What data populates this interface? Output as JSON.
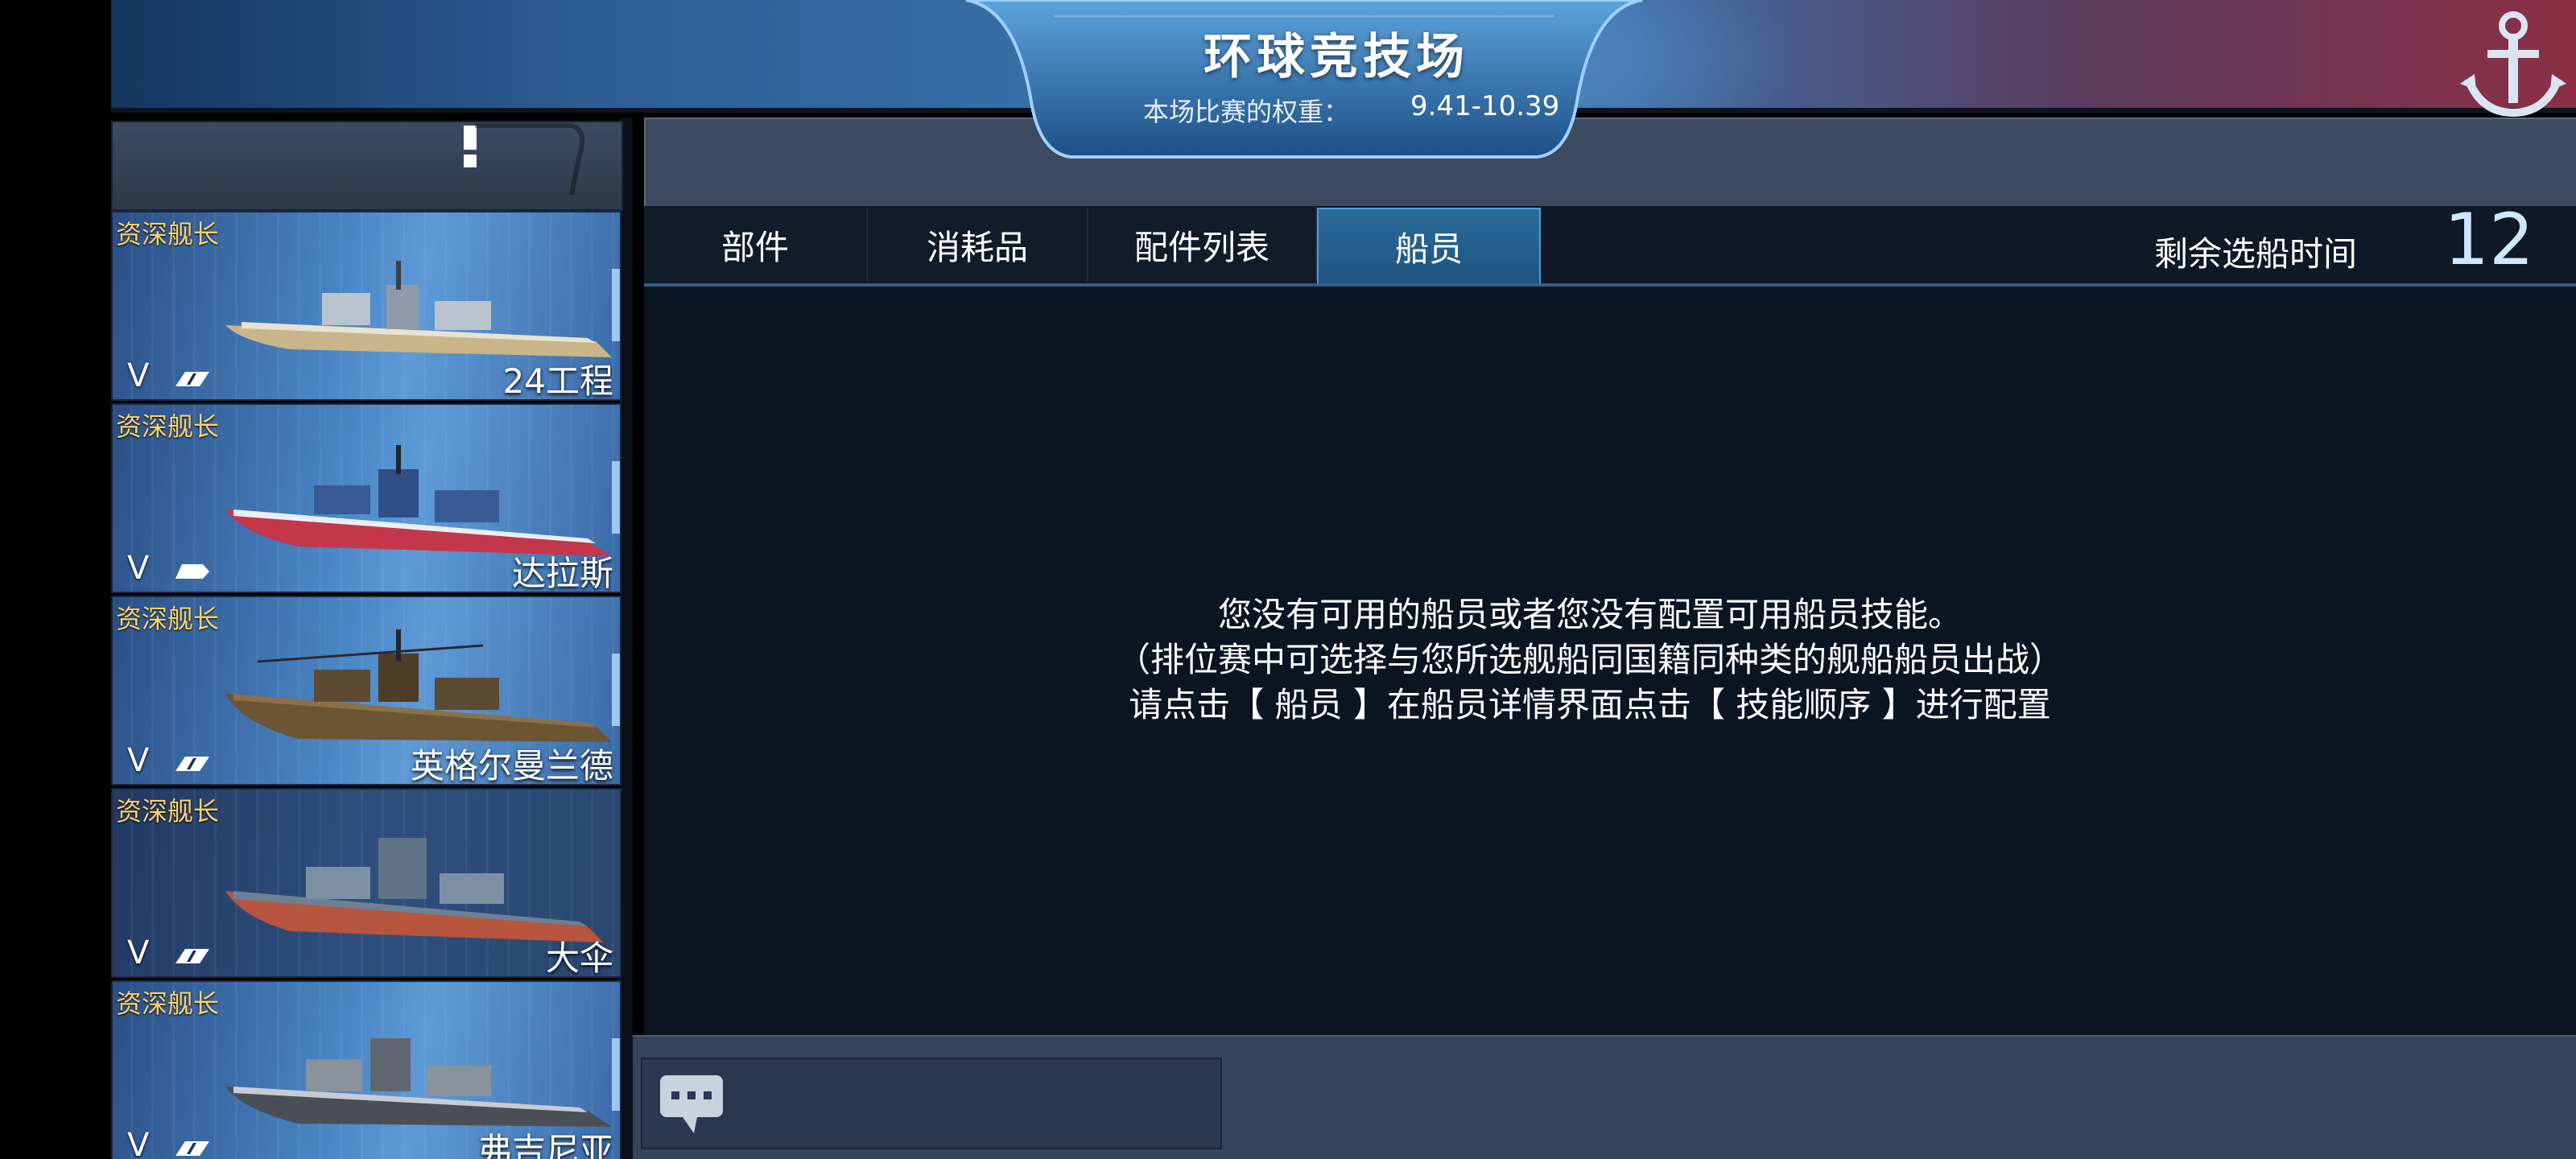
{
  "header": {
    "title": "环球竞技场",
    "weight_label": "本场比赛的权重：",
    "weight_value": "9.41-10.39"
  },
  "ships": [
    {
      "captain": "资深舰长",
      "tier": "V",
      "name": "24工程"
    },
    {
      "captain": "资深舰长",
      "tier": "V",
      "name": "达拉斯"
    },
    {
      "captain": "资深舰长",
      "tier": "V",
      "name": "英格尔曼兰德"
    },
    {
      "captain": "资深舰长",
      "tier": "V",
      "name": "大伞"
    },
    {
      "captain": "资深舰长",
      "tier": "V",
      "name": "弗吉尼亚"
    }
  ],
  "tabs": [
    {
      "label": "部件"
    },
    {
      "label": "消耗品"
    },
    {
      "label": "配件列表"
    },
    {
      "label": "船员",
      "active": true
    }
  ],
  "timer": {
    "label": "剩余选船时间",
    "value": "12"
  },
  "message": {
    "line1": "您没有可用的船员或者您没有配置可用船员技能。",
    "line2": "（排位赛中可选择与您所选舰船同国籍同种类的舰船船员出战）",
    "line3": "请点击【 船员 】在船员详情界面点击【 技能顺序 】进行配置"
  },
  "icons": {
    "anchor": "anchor-icon",
    "chat": "chat-bubble-icon",
    "ship_class": "battleship-class-icon"
  },
  "colors": {
    "captain_tag": "#ffd36b",
    "active_tab": "#1f5580",
    "content_bg": "#0b1421"
  }
}
